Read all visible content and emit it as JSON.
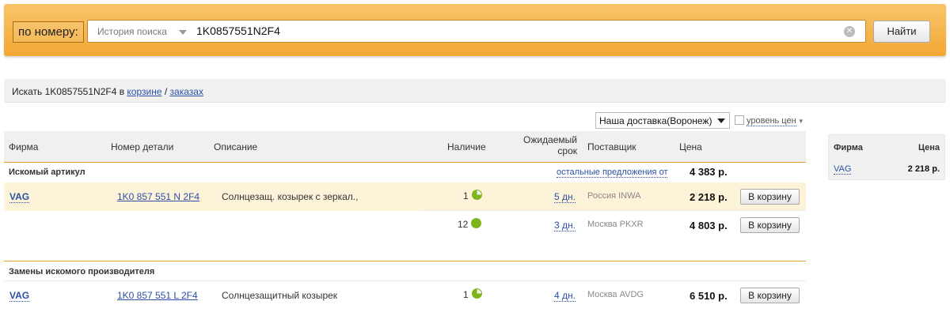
{
  "search": {
    "label": "по номеру:",
    "history_label": "История поиска",
    "query": "1K0857551N2F4",
    "find_button": "Найти"
  },
  "info": {
    "prefix": "Искать 1K0857551N2F4 в ",
    "cart_link": "корзине",
    "separator": " / ",
    "orders_link": "заказах"
  },
  "filters": {
    "delivery": "Наша доставка(Воронеж)",
    "price_level": "уровень цен"
  },
  "table": {
    "headers": {
      "brand": "Фирма",
      "part_number": "Номер детали",
      "description": "Описание",
      "availability": "Наличие",
      "expected_line1": "Ожидаемый",
      "expected_line2": "срок",
      "supplier": "Поставщик",
      "price": "Цена"
    },
    "section_searched": "Искомый артикул",
    "other_offers": "остальные предложения от",
    "other_offers_price": "4 383 р.",
    "section_replacements": "Замены искомого производителя",
    "cart_button": "В корзину",
    "rows": [
      {
        "brand": "VAG",
        "part": "1K0 857 551 N 2F4",
        "desc": "Солнцезащ. козырек с зеркал.,",
        "qty": "1",
        "days": "5 дн.",
        "supplier": "Россия INWA",
        "price": "2 218 р."
      },
      {
        "qty": "12",
        "days": "3 дн.",
        "supplier": "Москва PKXR",
        "price": "4 803 р."
      },
      {
        "brand": "VAG",
        "part": "1K0 857 551 L 2F4",
        "desc": "Солнцезащитный козырек",
        "qty": "1",
        "days": "4 дн.",
        "supplier": "Москва AVDG",
        "price": "6 510 р."
      }
    ]
  },
  "side": {
    "brand_header": "Фирма",
    "price_header": "Цена",
    "brand": "VAG",
    "price": "2 218 р."
  },
  "colors": {
    "accent_orange": "#f3a834",
    "link_blue": "#2b50a5",
    "stock_green": "#7fb51b",
    "highlight_row": "#fcf3d9"
  }
}
